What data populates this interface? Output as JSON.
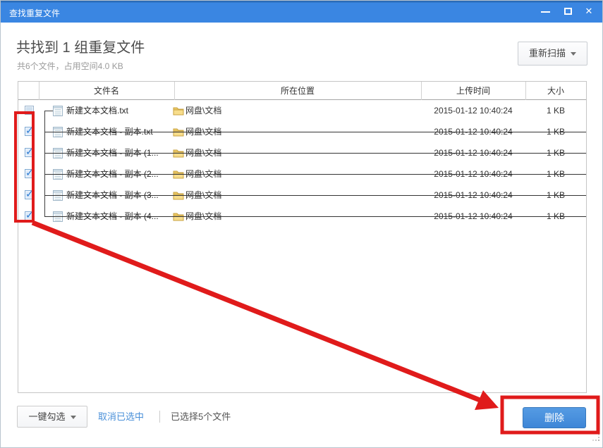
{
  "window": {
    "title": "查找重复文件"
  },
  "icons": {
    "close": "✕",
    "check": "✓"
  },
  "header": {
    "title": "共找到 1 组重复文件",
    "subtitle": "共6个文件，占用空间4.0 KB",
    "rescan_label": "重新扫描"
  },
  "table": {
    "columns": {
      "name": "文件名",
      "location": "所在位置",
      "time": "上传时间",
      "size": "大小"
    },
    "rows": [
      {
        "name": "新建文本文档.txt",
        "location": "网盘\\文档",
        "time": "2015-01-12 10:40:24",
        "size": "1 KB",
        "checked": false
      },
      {
        "name": "新建文本文档 - 副本.txt",
        "location": "网盘\\文档",
        "time": "2015-01-12 10:40:24",
        "size": "1 KB",
        "checked": true
      },
      {
        "name": "新建文本文档 - 副本 (1...",
        "location": "网盘\\文档",
        "time": "2015-01-12 10:40:24",
        "size": "1 KB",
        "checked": true
      },
      {
        "name": "新建文本文档 - 副本 (2...",
        "location": "网盘\\文档",
        "time": "2015-01-12 10:40:24",
        "size": "1 KB",
        "checked": true
      },
      {
        "name": "新建文本文档 - 副本 (3...",
        "location": "网盘\\文档",
        "time": "2015-01-12 10:40:24",
        "size": "1 KB",
        "checked": true
      },
      {
        "name": "新建文本文档 - 副本 (4...",
        "location": "网盘\\文档",
        "time": "2015-01-12 10:40:24",
        "size": "1 KB",
        "checked": true
      }
    ]
  },
  "footer": {
    "select_all_label": "一键勾选",
    "cancel_selected_label": "取消已选中",
    "selected_info": "已选择5个文件",
    "delete_label": "删除"
  },
  "colors": {
    "titlebar_blue": "#3a86e2",
    "button_blue": "#4690de",
    "link_blue": "#4a90d9",
    "annotation_red": "#e01b1b"
  }
}
